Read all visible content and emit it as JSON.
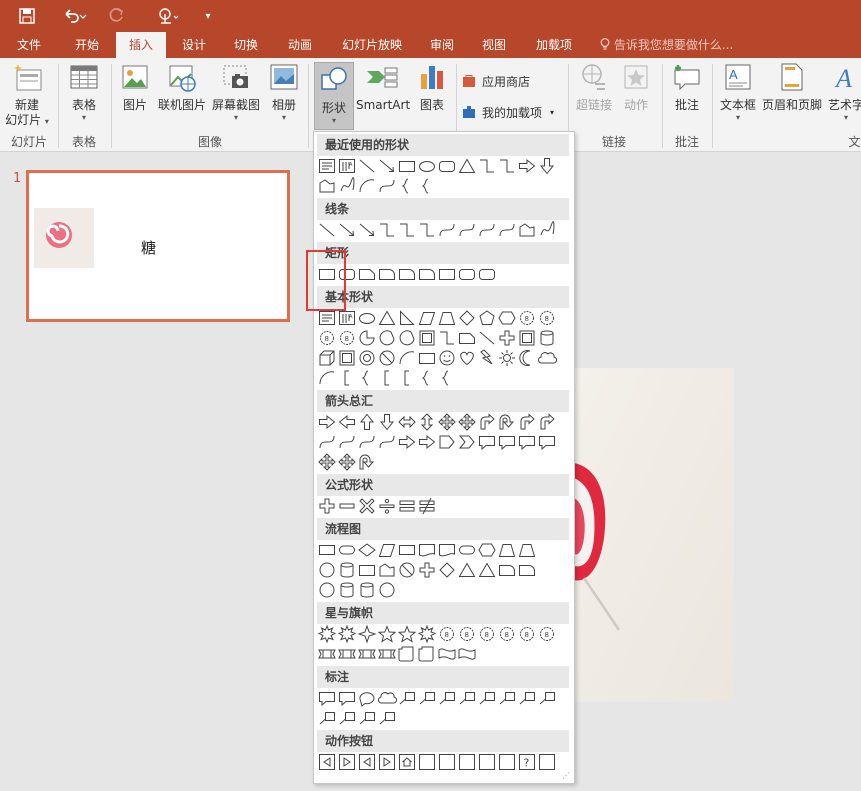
{
  "quick_access": {
    "save_icon": "save-icon",
    "undo_icon": "undo-icon",
    "redo_icon": "redo-icon",
    "touch_icon": "touch-mode-icon"
  },
  "tabs": [
    {
      "label": "文件",
      "active": false
    },
    {
      "label": "开始",
      "active": false
    },
    {
      "label": "插入",
      "active": true
    },
    {
      "label": "设计",
      "active": false
    },
    {
      "label": "切换",
      "active": false
    },
    {
      "label": "动画",
      "active": false
    },
    {
      "label": "幻灯片放映",
      "active": false
    },
    {
      "label": "审阅",
      "active": false
    },
    {
      "label": "视图",
      "active": false
    },
    {
      "label": "加载项",
      "active": false
    }
  ],
  "tell_me": "告诉我您想要做什么...",
  "ribbon": {
    "new_slide": {
      "line1": "新建",
      "line2": "幻灯片",
      "icon": "new-slide-icon"
    },
    "table": {
      "label": "表格",
      "icon": "table-icon"
    },
    "picture": {
      "label": "图片",
      "icon": "picture-icon"
    },
    "online_picture": {
      "label": "联机图片",
      "icon": "online-picture-icon"
    },
    "screenshot": {
      "label": "屏幕截图",
      "icon": "screenshot-icon"
    },
    "album": {
      "label": "相册",
      "icon": "photo-album-icon"
    },
    "shapes": {
      "label": "形状",
      "icon": "shapes-icon"
    },
    "smartart": {
      "label": "SmartArt",
      "icon": "smartart-icon"
    },
    "chart": {
      "label": "图表",
      "icon": "chart-icon"
    },
    "store": {
      "label": "应用商店",
      "icon": "store-icon"
    },
    "my_addins": {
      "label": "我的加载项",
      "icon": "my-addins-icon"
    },
    "hyperlink": {
      "label": "超链接",
      "icon": "hyperlink-icon"
    },
    "action": {
      "label": "动作",
      "icon": "action-icon"
    },
    "comment": {
      "label": "批注",
      "icon": "comment-icon"
    },
    "textbox": {
      "label": "文本框",
      "icon": "textbox-icon"
    },
    "header_footer": {
      "label": "页眉和页脚",
      "icon": "header-footer-icon"
    },
    "wordart": {
      "label": "艺术字",
      "icon": "wordart-icon"
    },
    "groups": {
      "slides": "幻灯片",
      "tables": "表格",
      "images": "图像",
      "links": "链接",
      "comments": "批注",
      "text": "文"
    }
  },
  "thumbnail": {
    "number": "1",
    "text": "糖"
  },
  "shapes_menu": {
    "categories": [
      "最近使用的形状",
      "线条",
      "矩形",
      "基本形状",
      "箭头总汇",
      "公式形状",
      "流程图",
      "星与旗帜",
      "标注",
      "动作按钮"
    ]
  },
  "colors": {
    "accent": "#b7472a",
    "highlight": "#e53935"
  }
}
